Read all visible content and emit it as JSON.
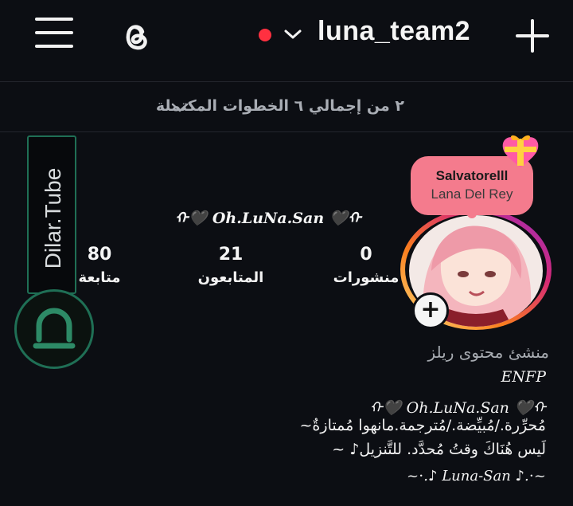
{
  "header": {
    "menu_icon": "hamburger-menu-icon",
    "threads_icon": "threads-logo-icon",
    "status_dot_color": "#ff3040",
    "account_switch_icon": "chevron-down-icon",
    "username": "luna_team2",
    "create_icon": "plus-icon"
  },
  "progress": {
    "text": "٢ من إجمالي ٦ الخطوات المكتملة",
    "icon": "chevron-down-icon"
  },
  "watermark": {
    "text": "Dilar.Tube"
  },
  "note": {
    "title": "Salvatorelll",
    "subtitle": "Lana Del Rey",
    "color": "#f47b8d",
    "sticker": "gift-heart-icon"
  },
  "profile": {
    "display_name": "ᡣ🖤 Oh.LuNa.San 🖤ᡣ",
    "ring_colors": [
      "#feda75",
      "#fa7e1e",
      "#d62976",
      "#962fbf"
    ]
  },
  "stats": {
    "posts": {
      "value": "0",
      "label": "منشورات"
    },
    "followers": {
      "value": "21",
      "label": "المتابعون"
    },
    "following": {
      "value": "80",
      "label": "متابعة"
    }
  },
  "bio": {
    "category": "منشئ محتوى ريلز",
    "line1": "ENFP",
    "line2": "ᡣ🖤 Oh.LuNa.San 🖤ᡣ",
    "line3": "مُحرِّرة./مُبيِّضة./مُترجمة.مانهوا مُمتازةٌ~",
    "line4": "لَيس هُنَاكَ وقتُ مُحدَّد. للتَّنزيل♪ ~",
    "line5": "~⋅.♪ Luna-San ♪.⋅~"
  }
}
